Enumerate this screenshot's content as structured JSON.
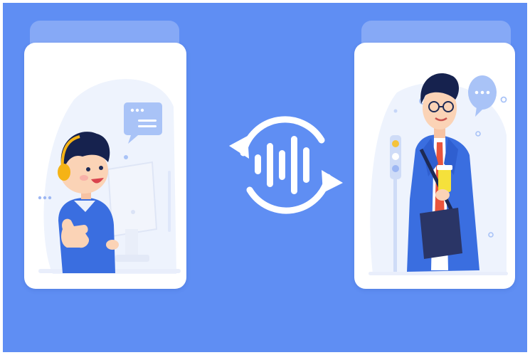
{
  "theme": {
    "background": "#5f8ef3",
    "tab": "#86a9f6",
    "card": "#ffffff",
    "accent_blue": "#3a6ee0",
    "skin": "#fbd3b6",
    "hair": "#16224e",
    "headset": "#f5b316",
    "soft": "#e7eefc"
  },
  "left_card": {
    "illustration": "boy-with-headset-at-computer",
    "icons": [
      "chat-bubble-icon",
      "monitor-icon",
      "headset-icon"
    ]
  },
  "center": {
    "icon": "voice-wave-sync-icon"
  },
  "right_card": {
    "illustration": "businessman-with-coffee-and-bag",
    "icons": [
      "chat-bubble-dots-icon",
      "traffic-light-icon"
    ]
  }
}
